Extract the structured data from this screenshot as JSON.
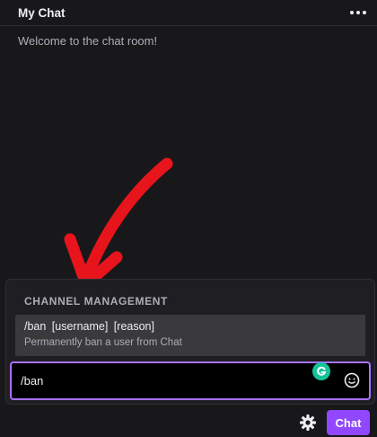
{
  "header": {
    "title": "My Chat",
    "more_icon": "more-horizontal-icon"
  },
  "messages": {
    "welcome": "Welcome to the chat room!"
  },
  "annotation": {
    "arrow_color": "#e8141c"
  },
  "suggestions": {
    "section_title": "CHANNEL MANAGEMENT",
    "items": [
      {
        "command": "/ban [username] [reason]",
        "description": "Permanently ban a user from Chat"
      }
    ]
  },
  "input": {
    "value": "/ban",
    "grammarly_icon": "grammarly-icon",
    "emoji_icon": "emoji-smile-icon"
  },
  "footer": {
    "settings_icon": "gear-icon",
    "chat_button_label": "Chat"
  },
  "colors": {
    "background": "#18181b",
    "panel": "#1f1f23",
    "suggestion": "#3a3a3d",
    "accent": "#9147ff",
    "focus_border": "#a970ff",
    "grammarly": "#15c39a"
  }
}
